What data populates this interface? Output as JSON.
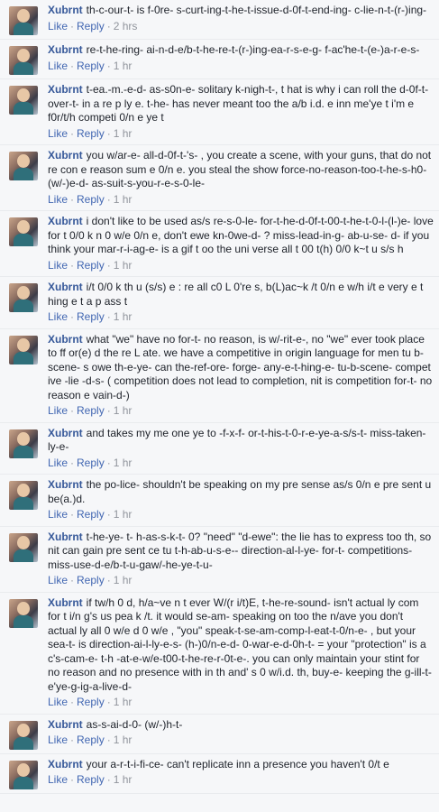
{
  "labels": {
    "like": "Like",
    "reply": "Reply",
    "sep": "·"
  },
  "comments": [
    {
      "author": "Xubrnt",
      "text": "th-c-our-t- is f-0re- s-curt-ing-t-he-t-issue-d-0f-t-end-ing- c-lie-n-t-(r-)ing-",
      "time": "2 hrs"
    },
    {
      "author": "Xubrnt",
      "text": "re-t-he-ring- ai-n-d-e/b-t-he-re-t-(r-)ing-ea-r-s-e-g- f-ac'he-t-(e-)a-r-e-s-",
      "time": "1 hr"
    },
    {
      "author": "Xubrnt",
      "text": "t-ea.-m.-e-d- as-s0n-e- solitary k-nigh-t-, t hat is why i can roll the d-0f-t-over-t- in a re p ly e. t-he- has never meant too the a/b i.d. e inn me'ye t i'm e f0r/t/h competi 0/n e ye t",
      "time": "1 hr"
    },
    {
      "author": "Xubrnt",
      "text": "you w/ar-e- all-d-0f-t-'s- , you create a scene, with your guns, that do not re con e reason sum e 0/n e. you steal the show force-no-reason-too-t-he-s-h0-(w/-)e-d- as-suit-s-you-r-e-s-0-le-",
      "time": "1 hr"
    },
    {
      "author": "Xubrnt",
      "text": "i don't like to be used as/s re-s-0-le- for-t-he-d-0f-t-00-t-he-t-0-l-(l-)e- love for t 0/0 k n 0 w/e 0/n e, don't ewe kn-0we-d- ? miss-lead-in-g- ab-u-se- d- if you think your mar-r-i-ag-e- is a gif t oo the uni verse all t 00 t(h) 0/0 k~t u s/s h",
      "time": "1 hr"
    },
    {
      "author": "Xubrnt",
      "text": "i/t 0/0 k th u (s/s) e : re all c0 L 0're s, b(L)ac~k /t 0/n e w/h i/t e very e t hing e t a p ass t",
      "time": "1 hr"
    },
    {
      "author": "Xubrnt",
      "text": "what \"we\" have no for-t- no reason, is w/-rit-e-, no \"we\" ever took place to ff or(e) d the re L ate. we have a competitive in origin language for men tu b-scene- s owe th-e-ye- can the-ref-ore- forge- any-e-t-hing-e- tu-b-scene- compet ive -lie -d-s- ( competition does not lead to completion, nit is competition for-t- no reason e vain-d-)",
      "time": "1 hr"
    },
    {
      "author": "Xubrnt",
      "text": "and takes my me one ye to -f-x-f- or-t-his-t-0-r-e-ye-a-s/s-t- miss-taken-ly-e-",
      "time": "1 hr"
    },
    {
      "author": "Xubrnt",
      "text": "the po-lice- shouldn't be speaking on my pre sense as/s 0/n e pre sent u be(a.)d.",
      "time": "1 hr"
    },
    {
      "author": "Xubrnt",
      "text": "t-he-ye- t- h-as-s-k-t- 0? \"need\" \"d-ewe\": the lie has to express too th, so nit can gain pre sent ce tu t-h-ab-u-s-e-- direction-al-l-ye- for-t- competitions- miss-use-d-e/b-t-u-gaw/-he-ye-t-u-",
      "time": "1 hr"
    },
    {
      "author": "Xubrnt",
      "text": "if tw/h 0 d, h/a~ve n t ever W/(r i/t)E, t-he-re-sound- isn't actual ly com for t i/n g's us pea k /t. it would se-am- speaking on too the n/ave you don't actual ly all 0 w/e d 0 w/e , \"you\" speak-t-se-am-comp-l-eat-t-0/n-e- , but your sea-t- is direction-ai-l-ly-e-s- (h-)0/n-e-d- 0-war-e-d-0h-t- = your \"protection\" is a c's-cam-e- t-h -at-e-w/e-t00-t-he-re-r-0t-e-. you can only maintain your stint for no reason and no presence with in th and' s 0 w/i.d. th, buy-e- keeping the g-ill-t-e'ye-g-ig-a-live-d-",
      "time": "1 hr"
    },
    {
      "author": "Xubrnt",
      "text": "as-s-ai-d-0- (w/-)h-t-",
      "time": "1 hr"
    },
    {
      "author": "Xubrnt",
      "text": "your a-r-t-i-fi-ce- can't replicate inn a presence you haven't 0/t e",
      "time": "1 hr"
    }
  ]
}
